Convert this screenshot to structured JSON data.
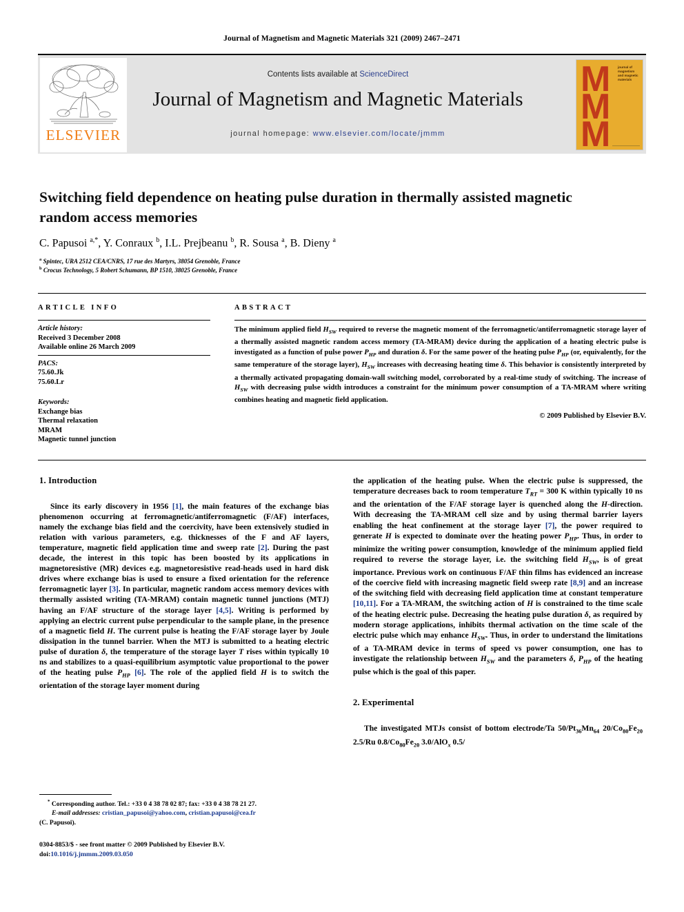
{
  "running_head": "Journal of Magnetism and Magnetic Materials 321 (2009) 2467–2471",
  "masthead": {
    "contents_prefix": "Contents lists available at ",
    "sciencedirect": "ScienceDirect",
    "journal_title": "Journal of Magnetism and Magnetic Materials",
    "homepage_label": "journal homepage: ",
    "homepage_url": "www.elsevier.com/locate/jmmm",
    "publisher_wordmark": "ELSEVIER",
    "cover_text": "journal of magnetism and magnetic materials",
    "cover_letter": "M",
    "accent_orange": "#f07c12",
    "link_blue": "#2b3f8c",
    "cover_yellow": "#e8ac2e",
    "cover_red": "#c1391b"
  },
  "article": {
    "title": "Switching field dependence on heating pulse duration in thermally assisted magnetic random access memories",
    "authors_html": "C. Papusoi <sup>a,</sup><sup>*</sup>, Y. Conraux <sup>b</sup>, I.L. Prejbeanu <sup>b</sup>, R. Sousa <sup>a</sup>, B. Dieny <sup>a</sup>",
    "affiliation_a": "Spintec, URA 2512 CEA/CNRS, 17 rue des Martyrs, 38054 Grenoble, France",
    "affiliation_b": "Crocus Technology, 5 Robert Schumann, BP 1510, 38025 Grenoble, France"
  },
  "info": {
    "heading": "ARTICLE INFO",
    "history_label": "Article history:",
    "received": "Received 3 December 2008",
    "available": "Available online 26 March 2009",
    "pacs_label": "PACS:",
    "pacs": [
      "75.60.Jk",
      "75.60.Lr"
    ],
    "keywords_label": "Keywords:",
    "keywords": [
      "Exchange bias",
      "Thermal relaxation",
      "MRAM",
      "Magnetic tunnel junction"
    ]
  },
  "abstract": {
    "heading": "ABSTRACT",
    "text_html": "The minimum applied field <i>H<sub>SW</sub></i> required to reverse the magnetic moment of the ferromagnetic/antiferromagnetic storage layer of a thermally assisted magnetic random access memory (TA-MRAM) device during the application of a heating electric pulse is investigated as a function of pulse power <i>P<sub>HP</sub></i> and duration <i>δ</i>. For the same power of the heating pulse <i>P<sub>HP</sub></i> (or, equivalently, for the same temperature of the storage layer), <i>H<sub>SW</sub></i> increases with decreasing heating time <i>δ</i>. This behavior is consistently interpreted by a thermally activated propagating domain-wall switching model, corroborated by a real-time study of switching. The increase of <i>H<sub>SW</sub></i> with decreasing pulse width introduces a constraint for the minimum power consumption of a TA-MRAM where writing combines heating and magnetic field application.",
    "copyright": "© 2009 Published by Elsevier B.V."
  },
  "sections": {
    "intro_heading": "1. Introduction",
    "intro_html": "Since its early discovery in 1956 <span class=\"cit\">[1]</span>, the main features of the exchange bias phenomenon occurring at ferromagnetic/antiferromagnetic (F/AF) interfaces, namely the exchange bias field and the coercivity, have been extensively studied in relation with various parameters, e.g. thicknesses of the F and AF layers, temperature, magnetic field application time and sweep rate <span class=\"cit\">[2]</span>. During the past decade, the interest in this topic has been boosted by its applications in magnetoresistive (MR) devices e.g. magnetoresistive read-heads used in hard disk drives where exchange bias is used to ensure a fixed orientation for the reference ferromagnetic layer <span class=\"cit\">[3]</span>. In particular, magnetic random access memory devices with thermally assisted writing (TA-MRAM) contain magnetic tunnel junctions (MTJ) having an F/AF structure of the storage layer <span class=\"cit\">[4,5]</span>. Writing is performed by applying an electric current pulse perpendicular to the sample plane, in the presence of a magnetic field <i>H</i>. The current pulse is heating the F/AF storage layer by Joule dissipation in the tunnel barrier. When the MTJ is submitted to a heating electric pulse of duration <i>δ</i>, the temperature of the storage layer <i>T</i> rises within typically 10 ns and stabilizes to a quasi-equilibrium asymptotic value proportional to the power of the heating pulse <i>P<sub>HP</sub></i> <span class=\"cit\">[6]</span>. The role of the applied field <i>H</i> is to switch the orientation of the storage layer moment during",
    "intro_cont_html": "the application of the heating pulse. When the electric pulse is suppressed, the temperature decreases back to room temperature <i>T<sub>RT</sub></i> = 300 K within typically 10 ns and the orientation of the F/AF storage layer is quenched along the <i>H</i>-direction. With decreasing the TA-MRAM cell size and by using thermal barrier layers enabling the heat confinement at the storage layer <span class=\"cit\">[7]</span>, the power required to generate <i>H</i> is expected to dominate over the heating power <i>P<sub>HP</sub></i>. Thus, in order to minimize the writing power consumption, knowledge of the minimum applied field required to reverse the storage layer, i.e. the switching field <i>H<sub>SW</sub></i>, is of great importance. Previous work on continuous F/AF thin films has evidenced an increase of the coercive field with increasing magnetic field sweep rate <span class=\"cit\">[8,9]</span> and an increase of the switching field with decreasing field application time at constant temperature <span class=\"cit\">[10,11]</span>. For a TA-MRAM, the switching action of <i>H</i> is constrained to the time scale of the heating electric pulse. Decreasing the heating pulse duration <i>δ</i>, as required by modern storage applications, inhibits thermal activation on the time scale of the electric pulse which may enhance <i>H<sub>SW</sub></i>. Thus, in order to understand the limitations of a TA-MRAM device in terms of speed vs power consumption, one has to investigate the relationship between <i>H<sub>SW</sub></i> and the parameters <i>δ</i>, <i>P<sub>HP</sub></i> of the heating pulse which is the goal of this paper.",
    "exp_heading": "2. Experimental",
    "exp_html": "The investigated MTJs consist of bottom electrode/Ta 50/Pt<sub>36</sub>Mn<sub>64</sub> 20/Co<sub>80</sub>Fe<sub>20</sub> 2.5/Ru 0.8/Co<sub>80</sub>Fe<sub>20</sub> 3.0/AlO<sub><i>x</i></sub> 0.5/"
  },
  "footnotes": {
    "corresponding_html": "<sup>*</sup> Corresponding author. Tel.: +33 0 4 38 78 02 87; fax: +33 0 4 38 78 21 27.",
    "email_html": "<i>E-mail addresses:</i> <span class=\"mail\">cristian_papusoi@yahoo.com</span>, <span class=\"mail\">cristian.papusoi@cea.fr</span>",
    "email_attrib": "(C. Papusoi).",
    "issn_line": "0304-8853/$ - see front matter © 2009 Published by Elsevier B.V.",
    "doi_label": "doi:",
    "doi_value": "10.1016/j.jmmm.2009.03.050"
  }
}
